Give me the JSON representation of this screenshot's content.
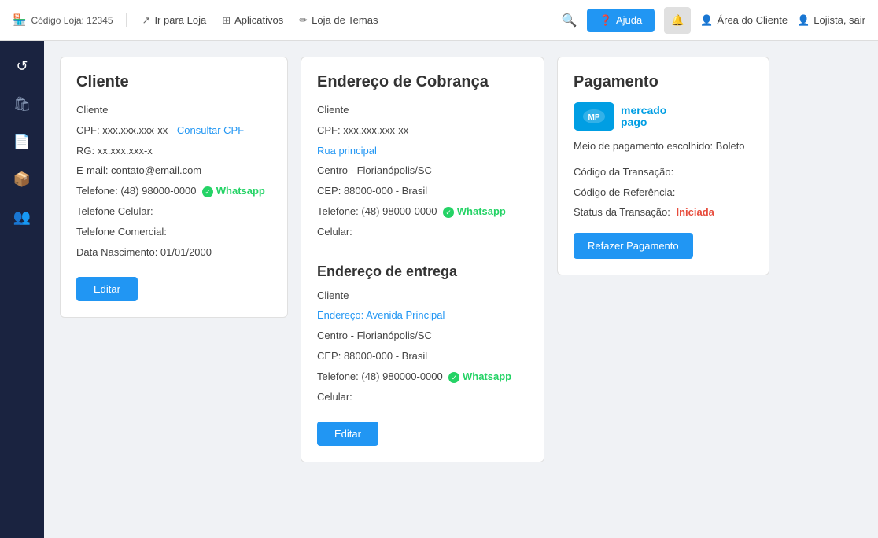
{
  "topnav": {
    "brand_label": "Código Loja: 12345",
    "link_store": "Ir para Loja",
    "link_apps": "Aplicativos",
    "link_themes": "Loja de Temas",
    "btn_ajuda": "Ajuda",
    "btn_area": "Área do Cliente",
    "btn_user": "Lojista, sair"
  },
  "sidebar": {
    "items": [
      {
        "name": "refresh-icon",
        "icon": "↺"
      },
      {
        "name": "bag-icon",
        "icon": "🛍"
      },
      {
        "name": "document-icon",
        "icon": "📄"
      },
      {
        "name": "box-icon",
        "icon": "📦"
      },
      {
        "name": "people-icon",
        "icon": "👥"
      }
    ]
  },
  "card_cliente": {
    "title": "Cliente",
    "row_cliente": "Cliente",
    "cpf_label": "CPF: xxx.xxx.xxx-xx",
    "consultar_cpf": "Consultar CPF",
    "rg": "RG: xx.xxx.xxx-x",
    "email": "E-mail: contato@email.com",
    "telefone": "Telefone: (48) 98000-0000",
    "whatsapp": "Whatsapp",
    "telefone_celular": "Telefone Celular:",
    "telefone_comercial": "Telefone Comercial:",
    "data_nascimento": "Data Nascimento: 01/01/2000",
    "btn_editar": "Editar"
  },
  "card_endereco_cobranca": {
    "title": "Endereço de Cobrança",
    "row_cliente": "Cliente",
    "cpf": "CPF: xxx.xxx.xxx-xx",
    "rua": "Rua principal",
    "bairro_cidade": "Centro - Florianópolis/SC",
    "cep_pais": "CEP: 88000-000 - Brasil",
    "telefone": "Telefone: (48) 98000-0000",
    "whatsapp": "Whatsapp",
    "celular": "Celular:"
  },
  "card_endereco_entrega": {
    "title": "Endereço de entrega",
    "row_cliente": "Cliente",
    "endereco": "Endereço: Avenida Principal",
    "bairro_cidade": "Centro - Florianópolis/SC",
    "cep_pais": "CEP: 88000-000 - Brasil",
    "telefone": "Telefone: (48) 980000-0000",
    "whatsapp": "Whatsapp",
    "celular": "Celular:",
    "btn_editar": "Editar"
  },
  "card_pagamento": {
    "title": "Pagamento",
    "mp_line1": "mercado",
    "mp_line2": "pago",
    "meio_pagamento": "Meio de pagamento escolhido: Boleto",
    "codigo_transacao": "Código da Transação:",
    "codigo_referencia": "Código de Referência:",
    "status_transacao": "Status da Transação:",
    "status_value": "Iniciada",
    "btn_refazer": "Refazer Pagamento"
  },
  "colors": {
    "whatsapp": "#25d366",
    "link_blue": "#2196f3",
    "status_red": "#e74c3c",
    "mp_blue": "#009ee3"
  }
}
